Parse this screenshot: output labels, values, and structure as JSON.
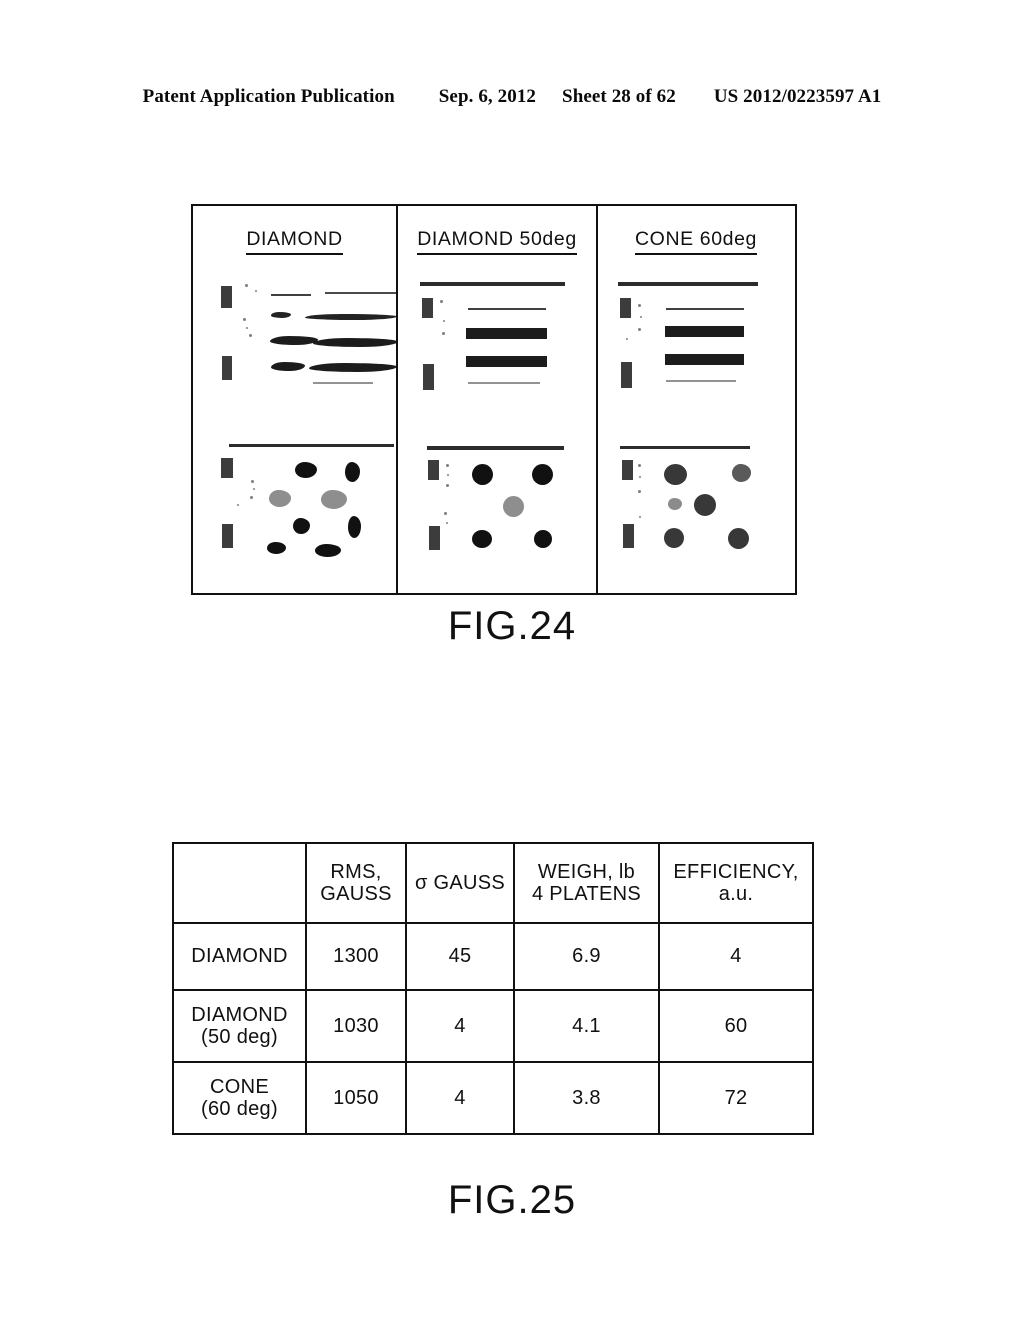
{
  "header": {
    "publication": "Patent Application Publication",
    "date": "Sep. 6, 2012",
    "sheet": "Sheet 28 of 62",
    "doc_number": "US 2012/0223597 A1"
  },
  "figures": [
    {
      "id": "fig24",
      "caption": "FIG.24",
      "panels": [
        {
          "title": "DIAMOND"
        },
        {
          "title": "DIAMOND  50deg"
        },
        {
          "title": "CONE  60deg"
        }
      ]
    },
    {
      "id": "fig25",
      "caption": "FIG.25"
    }
  ],
  "table": {
    "columns": [
      {
        "line1": "",
        "line2": ""
      },
      {
        "line1": "RMS,",
        "line2": "GAUSS"
      },
      {
        "line1": "",
        "line2": "σ GAUSS"
      },
      {
        "line1": "WEIGH, lb",
        "line2": "4  PLATENS"
      },
      {
        "line1": "EFFICIENCY,",
        "line2": "a.u."
      }
    ],
    "rows": [
      {
        "label_line1": "DIAMOND",
        "label_line2": "",
        "rms_gauss": "1300",
        "sigma_gauss": "45",
        "weigh_lb": "6.9",
        "efficiency": "4"
      },
      {
        "label_line1": "DIAMOND",
        "label_line2": "(50  deg)",
        "rms_gauss": "1030",
        "sigma_gauss": "4",
        "weigh_lb": "4.1",
        "efficiency": "60"
      },
      {
        "label_line1": "CONE",
        "label_line2": "(60  deg)",
        "rms_gauss": "1050",
        "sigma_gauss": "4",
        "weigh_lb": "3.8",
        "efficiency": "72"
      }
    ]
  },
  "colors": {
    "ink": "#111111",
    "page": "#ffffff"
  }
}
